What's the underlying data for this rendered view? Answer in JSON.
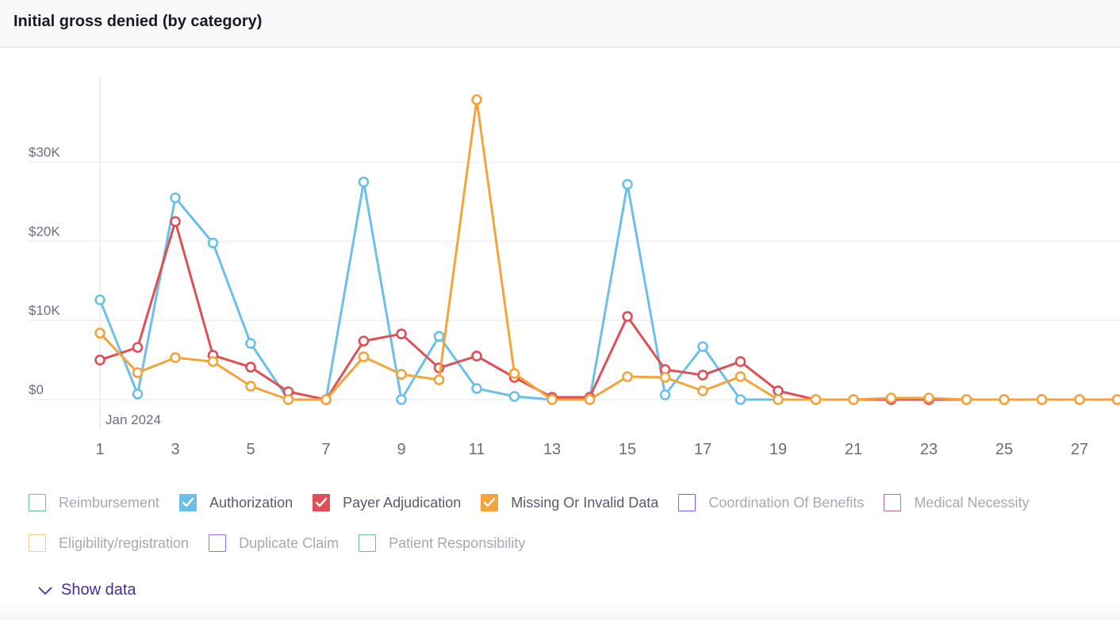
{
  "header": {
    "title": "Initial gross denied (by category)"
  },
  "chart_data": {
    "type": "line",
    "title": "Initial gross denied (by category)",
    "xlabel": "",
    "x_sublabel": "Jan 2024",
    "ylabel": "",
    "ylim": [
      0,
      40000
    ],
    "yticks": [
      0,
      10000,
      20000,
      30000
    ],
    "ytick_labels": [
      "$0",
      "$10K",
      "$20K",
      "$30K"
    ],
    "x": [
      1,
      2,
      3,
      4,
      5,
      6,
      7,
      8,
      9,
      10,
      11,
      12,
      13,
      14,
      15,
      16,
      17,
      18,
      19,
      20,
      21,
      22,
      23,
      24,
      25,
      26,
      27,
      28
    ],
    "xticks": [
      1,
      3,
      5,
      7,
      9,
      11,
      13,
      15,
      17,
      19,
      21,
      23,
      25,
      27
    ],
    "xtick_labels": [
      "1",
      "3",
      "5",
      "7",
      "9",
      "11",
      "13",
      "15",
      "17",
      "19",
      "21",
      "23",
      "25",
      "27"
    ],
    "grid": true,
    "legend_position": "bottom",
    "series": [
      {
        "name": "Authorization",
        "color": "#6bc0ea",
        "values": [
          12600,
          700,
          25500,
          19800,
          7100,
          0,
          0,
          27500,
          0,
          8000,
          1400,
          400,
          0,
          0,
          27200,
          600,
          6700,
          0,
          0,
          0,
          0,
          0,
          0,
          0,
          0,
          0,
          0,
          0
        ]
      },
      {
        "name": "Payer Adjudication",
        "color": "#df4f57",
        "values": [
          5000,
          6600,
          22500,
          5600,
          4100,
          1000,
          0,
          7400,
          8300,
          4000,
          5500,
          2800,
          300,
          300,
          10500,
          3800,
          3100,
          4800,
          1100,
          0,
          0,
          0,
          0,
          0,
          0,
          0,
          0,
          0
        ]
      },
      {
        "name": "Missing Or Invalid Data",
        "color": "#f3a53b",
        "values": [
          8400,
          3400,
          5300,
          4800,
          1700,
          0,
          0,
          5400,
          3200,
          2500,
          37900,
          3300,
          0,
          0,
          2900,
          2800,
          1100,
          2900,
          0,
          0,
          0,
          200,
          200,
          0,
          0,
          0,
          0,
          0
        ]
      }
    ]
  },
  "legend": {
    "rows": [
      [
        {
          "label": "Reimbursement",
          "color": "#6cc08e",
          "checked": false
        },
        {
          "label": "Authorization",
          "color": "#6bc0ea",
          "checked": true
        },
        {
          "label": "Payer Adjudication",
          "color": "#df4f57",
          "checked": true
        },
        {
          "label": "Missing Or Invalid Data",
          "color": "#f3a53b",
          "checked": true
        },
        {
          "label": "Coordination Of Benefits",
          "color": "#8b5cf0",
          "checked": false
        },
        {
          "label": "Medical Necessity",
          "color": "#b46aa6",
          "checked": false
        }
      ],
      [
        {
          "label": "Eligibility/registration",
          "color": "#f5cf8f",
          "checked": false
        },
        {
          "label": "Duplicate Claim",
          "color": "#9c6cf0",
          "checked": false
        },
        {
          "label": "Patient Responsibility",
          "color": "#6cc08e",
          "checked": false
        }
      ]
    ]
  },
  "show_data": {
    "label": "Show data",
    "icon": "chevron-down-icon"
  }
}
